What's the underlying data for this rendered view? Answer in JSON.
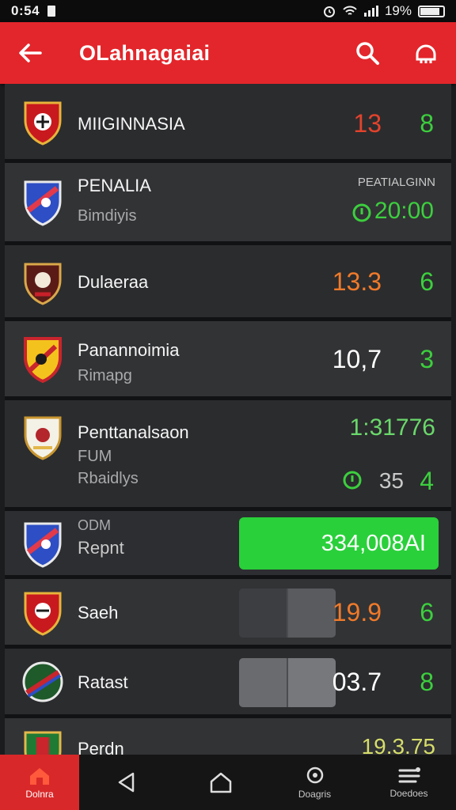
{
  "status_bar": {
    "time": "0:54",
    "battery": "19%"
  },
  "header": {
    "title": "OLahnagaiai"
  },
  "rows": [
    {
      "name": "MIIGINNASIA",
      "score": "13",
      "goal": "8"
    },
    {
      "name": "PENALIA",
      "sub": "Bimdiyis",
      "label": "PEATIALGINN",
      "goal": "20:00"
    },
    {
      "name": "Dulaeraa",
      "score": "13.3",
      "goal": "6"
    },
    {
      "name": "Panannoimia",
      "sub": "Rimapg",
      "score": "10,7",
      "goal": "3"
    },
    {
      "name": "Penttanalsaon",
      "sub1": "FUM",
      "sub2": "Rbaidlys",
      "top_value": "1:31776",
      "score": "35",
      "goal": "4"
    },
    {
      "name": "ODM",
      "sub": "Repnt",
      "bar_value": "334,008AI"
    },
    {
      "name": "Saeh",
      "score": "19.9",
      "goal": "6"
    },
    {
      "name": "Ratast",
      "score": "03.7",
      "goal": "8"
    },
    {
      "name": "Perdn",
      "score": "19.3.",
      "goal": "75"
    }
  ],
  "bottom_nav": {
    "home": "Dolnra",
    "item3": "Doagris",
    "item4": "Doedoes"
  },
  "colors": {
    "accent": "#e3262b",
    "green": "#29d03a",
    "score_red": "#e2432c",
    "score_orange": "#f07a2a"
  }
}
